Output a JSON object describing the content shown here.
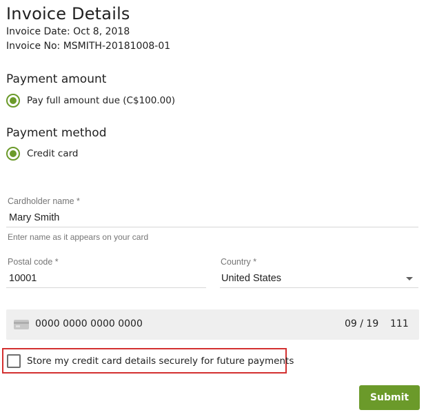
{
  "invoice": {
    "title": "Invoice Details",
    "date": "Invoice Date: Oct 8, 2018",
    "number": "Invoice No: MSMITH-20181008-01"
  },
  "payment_amount": {
    "title": "Payment amount",
    "option_label": "Pay full amount due (C$100.00)",
    "selected": true
  },
  "payment_method": {
    "title": "Payment method",
    "option_label": "Credit card",
    "selected": true
  },
  "form": {
    "cardholder_label": "Cardholder name *",
    "cardholder_value": "Mary Smith",
    "cardholder_helper": "Enter name as it appears on your card",
    "postal_label": "Postal code *",
    "postal_value": "10001",
    "country_label": "Country *",
    "country_value": "United States"
  },
  "card": {
    "icon": "credit-card-icon",
    "number_placeholder": "0000 0000 0000 0000",
    "expiry": "09 / 19",
    "cvc": "111"
  },
  "store_card": {
    "label": "Store my credit card details securely for future payments",
    "checked": false,
    "highlight_color": "#d32f2f"
  },
  "submit_label": "Submit",
  "colors": {
    "accent": "#6b9a2a"
  }
}
